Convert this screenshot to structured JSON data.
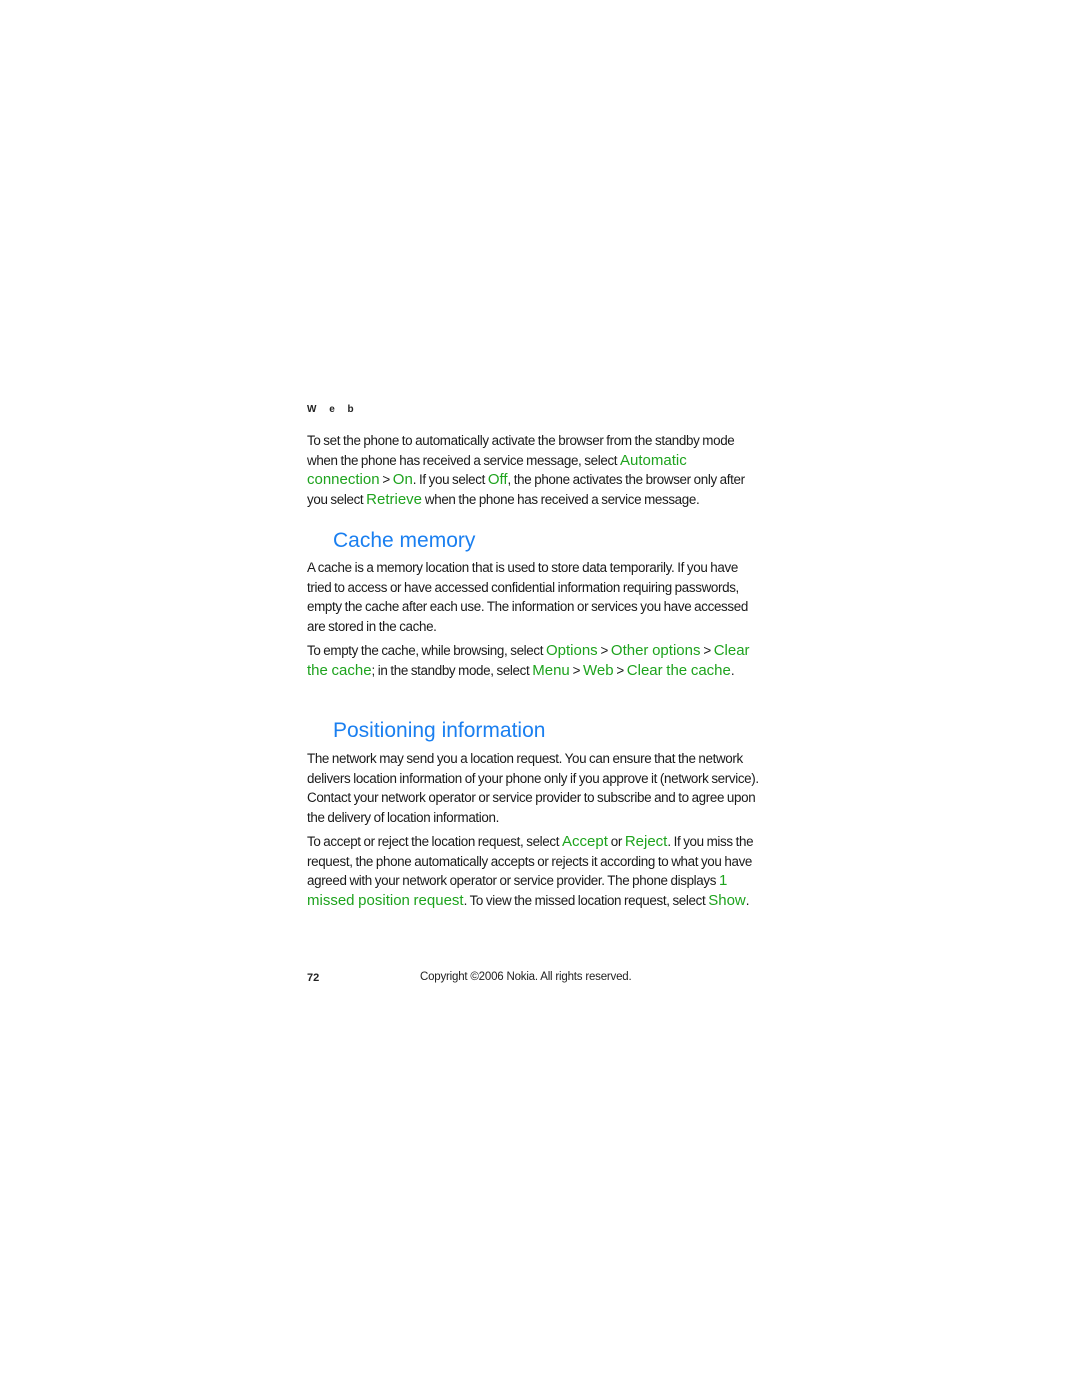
{
  "running_head": "W e b",
  "intro": {
    "t1": "To set the phone to automatically activate the browser from the standby mode when the phone has received a service message, select ",
    "u1": "Automatic connection",
    "t2": " > ",
    "u2": "On",
    "t3": ". If you select ",
    "u3": "Off",
    "t4": ", the phone activates the browser only after you select ",
    "u4": "Retrieve",
    "t5": " when the phone has received a service message."
  },
  "cache_section": {
    "heading": "Cache memory",
    "para1": "A cache is a memory location that is used to store data temporarily. If you have tried to access or have accessed confidential information requiring passwords, empty the cache after each use. The information or services you have accessed are stored in the cache.",
    "para2": {
      "t1": "To empty the cache, while browsing, select ",
      "u1": "Options",
      "t2": " > ",
      "u2": "Other options",
      "t3": " > ",
      "u3": "Clear the cache",
      "t4": "; in the standby mode, select ",
      "u4": "Menu",
      "t5": " > ",
      "u5": "Web",
      "t6": " > ",
      "u6": "Clear the cache",
      "t7": "."
    }
  },
  "positioning_section": {
    "heading": "Positioning information",
    "para1": "The network may send you a location request. You can ensure that the network delivers location information of your phone only if you approve it (network service). Contact your network operator or service provider to subscribe and to agree upon the delivery of location information.",
    "para2": {
      "t1": "To accept or reject the location request, select ",
      "u1": "Accept",
      "t2": " or ",
      "u2": "Reject",
      "t3": ". If you miss the request, the phone automatically accepts or rejects it according to what you have agreed with your network operator or service provider. The phone displays ",
      "u3": "1 missed position request",
      "t4": ". To view the missed location request, select ",
      "u4": "Show",
      "t5": "."
    }
  },
  "footer": {
    "page_number": "72",
    "copyright": "Copyright ©2006 Nokia. All rights reserved."
  },
  "colors": {
    "heading": "#1a7ff0",
    "ui_term": "#1ea31e"
  }
}
